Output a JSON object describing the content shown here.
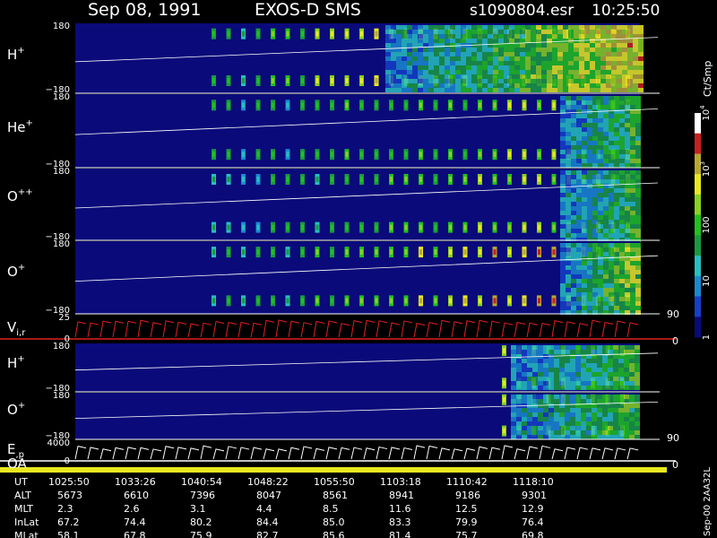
{
  "header": {
    "date": "Sep 08, 1991",
    "mission": "EXOS-D SMS",
    "file": "s1090804.esr",
    "time": "10:25:50"
  },
  "colorbar": {
    "unit": "Ct/Smp",
    "ticks": [
      {
        "label": "1",
        "value": 1
      },
      {
        "label": "10",
        "value": 10
      },
      {
        "label": "100",
        "value": 100
      },
      {
        "label": "10",
        "sup": "3",
        "value": 1000
      },
      {
        "label": "10",
        "sup": "4",
        "value": 10000
      }
    ],
    "colors": [
      "#0a0a7a",
      "#1540c8",
      "#1a8ad0",
      "#26c0c0",
      "#1a9a40",
      "#20c020",
      "#8ad020",
      "#e8e820",
      "#b8a830",
      "#c82020",
      "#ffffff"
    ]
  },
  "side_labels": {
    "vel_upper": "90",
    "vel_lower": "0",
    "energy_upper": "90",
    "energy_lower": "0",
    "footer_id": "Sep-00  2AA32L"
  },
  "chart_data": {
    "type": "heatmap",
    "panels": [
      {
        "label": "H",
        "sup": "+",
        "ymax": "180",
        "ymin": "−180"
      },
      {
        "label": "He",
        "sup": "+",
        "ymax": "180",
        "ymin": "−180"
      },
      {
        "label": "O",
        "sup": "++",
        "ymax": "180",
        "ymin": "−180"
      },
      {
        "label": "O",
        "sup": "+",
        "ymax": "180",
        "ymin": "−180"
      },
      {
        "label": "V",
        "sub": "i",
        "suffix": "r",
        "ymax": "25",
        "ymin": "0",
        "type": "line"
      },
      {
        "label": "H",
        "sup": "+",
        "ymax": "180",
        "ymin": "−180"
      },
      {
        "label": "O",
        "sup": "+",
        "ymax": "180",
        "ymin": "−180"
      },
      {
        "label": "E",
        "sub": "",
        "suffix": "p",
        "ymax": "4000",
        "ymin": "0",
        "type": "line"
      },
      {
        "label": "OA",
        "ymax": "",
        "ymin": "",
        "type": "bar"
      }
    ],
    "x_times": [
      "1025:50",
      "1033:26",
      "1040:54",
      "1048:22",
      "1055:50",
      "1103:18",
      "1110:42",
      "1118:10"
    ],
    "ephemeris": [
      {
        "name": "UT",
        "values": [
          "1025:50",
          "1033:26",
          "1040:54",
          "1048:22",
          "1055:50",
          "1103:18",
          "1110:42",
          "1118:10"
        ]
      },
      {
        "name": "ALT",
        "values": [
          "5673",
          "6610",
          "7396",
          "8047",
          "8561",
          "8941",
          "9186",
          "9301"
        ]
      },
      {
        "name": "MLT",
        "values": [
          "2.3",
          "2.6",
          "3.1",
          "4.4",
          "8.5",
          "11.6",
          "12.5",
          "12.9"
        ]
      },
      {
        "name": "InLat",
        "values": [
          "67.2",
          "74.4",
          "80.2",
          "84.4",
          "85.0",
          "83.3",
          "79.9",
          "76.4"
        ]
      },
      {
        "name": "MLat",
        "values": [
          "58.1",
          "67.8",
          "75.9",
          "82.7",
          "85.6",
          "81.4",
          "75.7",
          "69.8"
        ]
      }
    ]
  }
}
